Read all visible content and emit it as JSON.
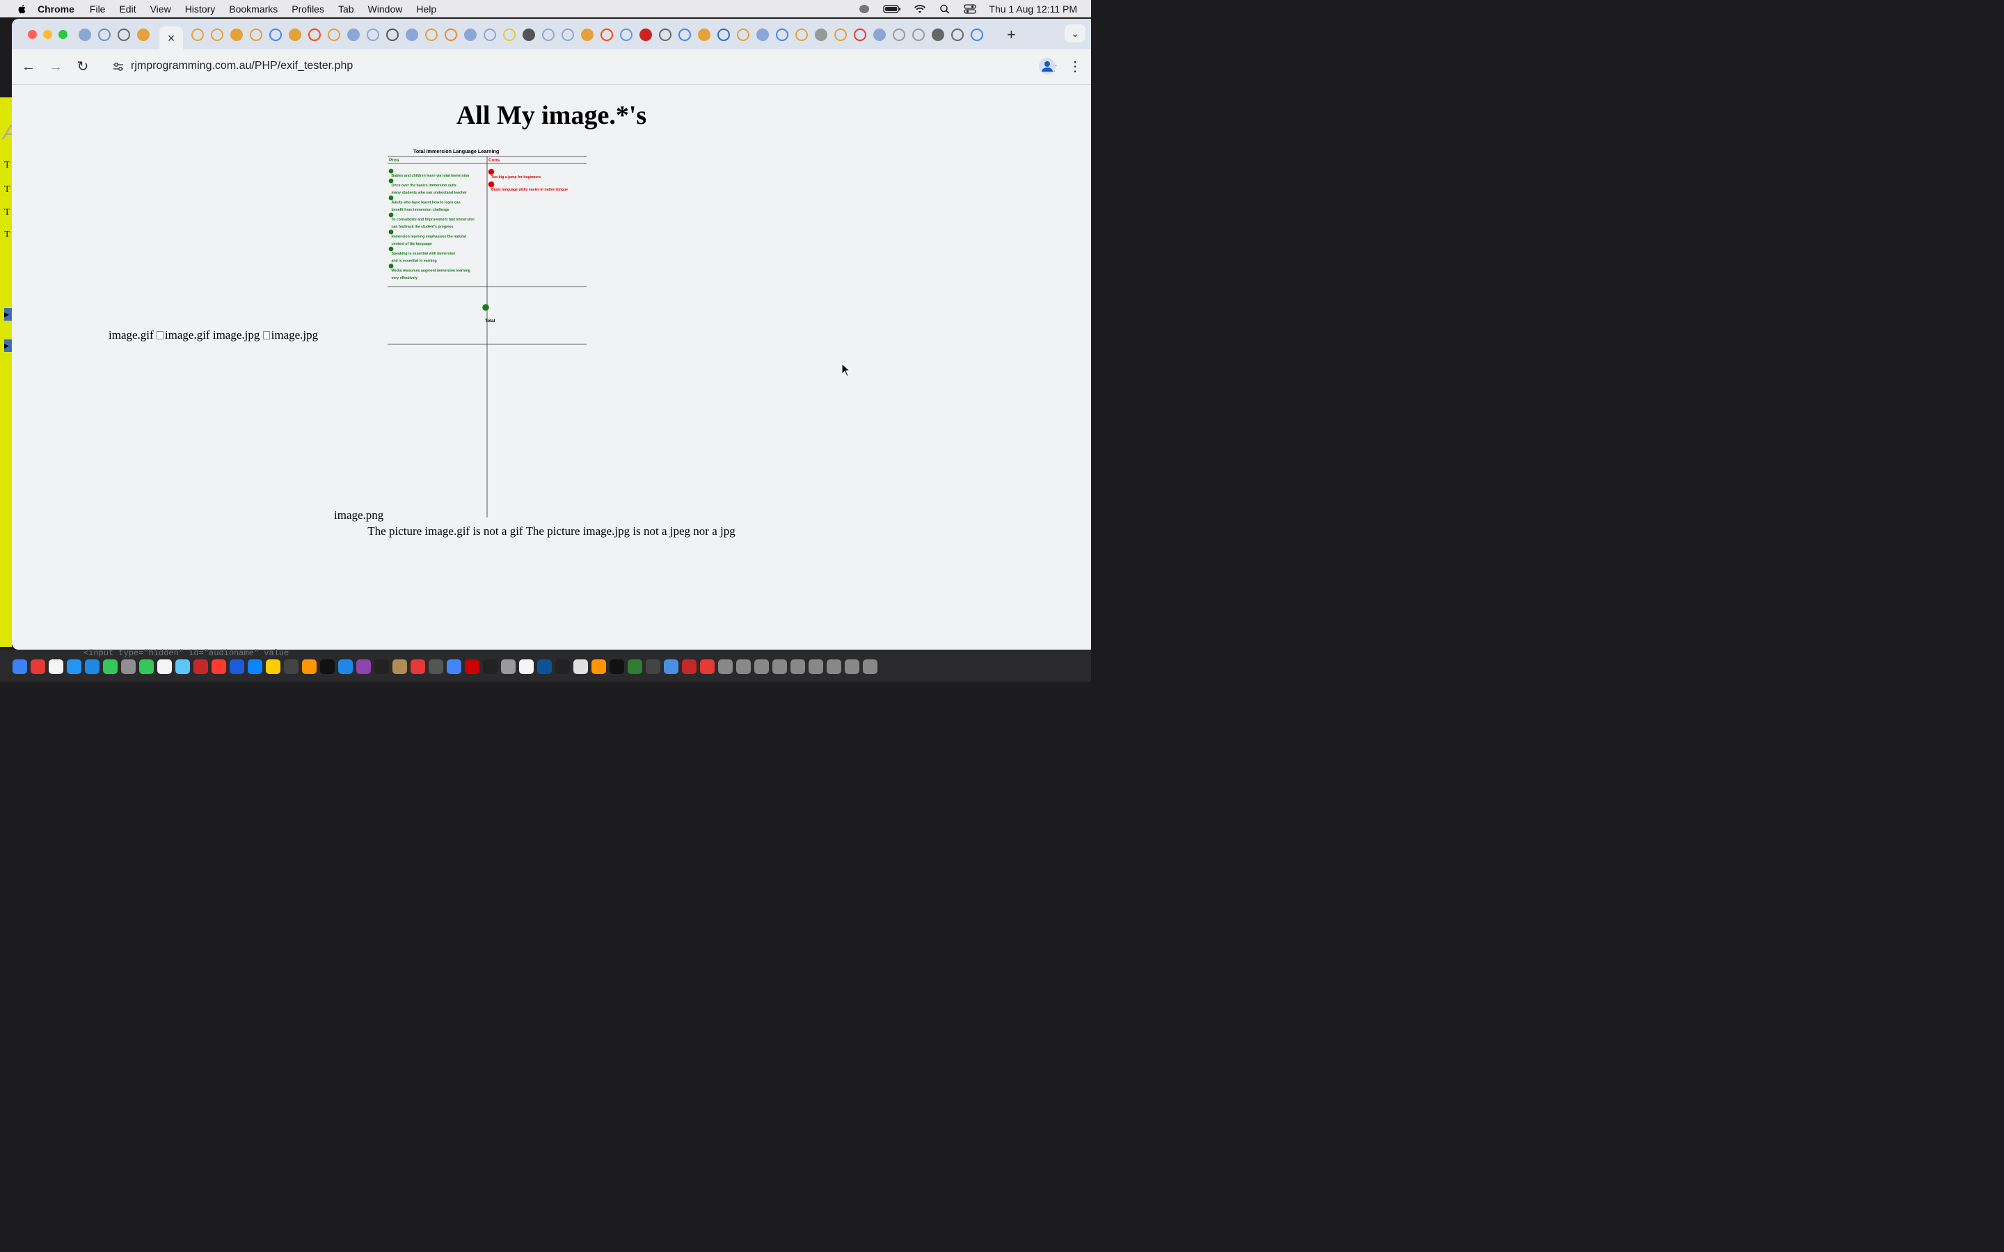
{
  "menubar": {
    "app": "Chrome",
    "items": [
      "File",
      "Edit",
      "View",
      "History",
      "Bookmarks",
      "Profiles",
      "Tab",
      "Window",
      "Help"
    ],
    "clock": "Thu 1 Aug  12:11 PM"
  },
  "background_window": {
    "side_letters": [
      "T",
      "T",
      "T",
      "T"
    ],
    "dock_code": "<input type=\"hidden\" id=\"audioname\" value"
  },
  "browser": {
    "url": "rjmprogramming.com.au/PHP/exif_tester.php",
    "active_tab_close": "×",
    "new_tab": "+",
    "tab_favicon_colors": [
      "#8aa7d8",
      "#6e8fbf",
      "#666",
      "#e5a13a",
      "#e5a13a",
      "#e5a13a",
      "#e5a13a",
      "#e5a13a",
      "#4285f4",
      "#e5a13a",
      "#ff4500",
      "#e5a13a",
      "#8aa7d8",
      "#8aa7d8",
      "#555",
      "#8aa7d8",
      "#e5a13a",
      "#f08a24",
      "#8aa7d8",
      "#8aa7d8",
      "#e8c93a",
      "#555",
      "#8aa7d8",
      "#8aa7d8",
      "#e5a13a",
      "#ff4500",
      "#5b9bd5",
      "#cc2222",
      "#666",
      "#4285f4",
      "#e5a13a",
      "#2a6cc4",
      "#e5a13a",
      "#8aa7d8",
      "#4285f4",
      "#e5a13a",
      "#999",
      "#e5a13a",
      "#e53935",
      "#8aa7d8",
      "#999",
      "#999",
      "#666",
      "#666",
      "#4285f4"
    ]
  },
  "page": {
    "heading": "All My image.*'s",
    "gif_label": "image.gif",
    "gif_alt": "image.gif",
    "jpg_label": "image.jpg",
    "jpg_alt": "image.jpg",
    "png_label": "image.png",
    "message": "The picture image.gif is not a gif The picture image.jpg is not a jpeg nor a jpg"
  },
  "chart_data": {
    "type": "table",
    "title": "Total Immersion Language Learning",
    "columns": [
      "Pros",
      "Cons"
    ],
    "pros": [
      [
        "Babies and children learn via total immersion"
      ],
      [
        "Once over the basics immersion suits",
        "many students who can understand teacher"
      ],
      [
        "Adults who have learnt how to learn can",
        "benefit from immersion challenge"
      ],
      [
        "To consolidate and improvement fast immersion",
        "can fasttrack the student's progress"
      ],
      [
        "Immersion learning emphasises the natural",
        "context of the language"
      ],
      [
        "Speaking is essential with immersion",
        "and is essential to earning"
      ],
      [
        "Media resources augment immersion learning",
        "very effectively"
      ]
    ],
    "cons": [
      [
        "Too big a jump for beginners"
      ],
      [
        "Basic language skills easier in native tongue"
      ]
    ],
    "total_label": "Total",
    "pros_color": "#1a7a1a",
    "cons_color": "#e00000"
  }
}
